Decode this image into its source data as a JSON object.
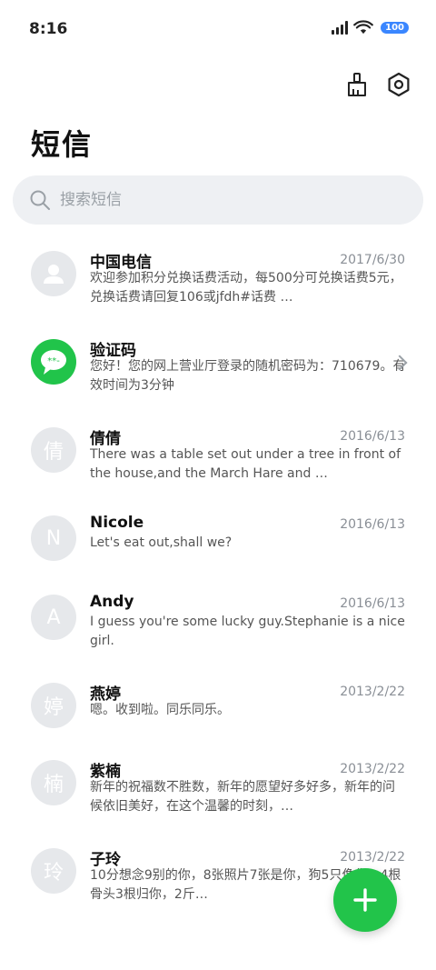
{
  "status": {
    "time": "8:16",
    "battery": "100"
  },
  "header": {
    "title": "短信"
  },
  "search": {
    "placeholder": "搜索短信"
  },
  "conversations": [
    {
      "name": "中国电信",
      "date": "2017/6/30",
      "preview": "欢迎参加积分兑换话费活动，每500分可兑换话费5元，兑换话费请回复106或jfdh#话费 …",
      "avatar": "person-icon"
    },
    {
      "name": "验证码",
      "date": "",
      "preview": "您好！您的网上营业厅登录的随机密码为：710679。有效时间为3分钟",
      "avatar": "message-icon"
    },
    {
      "name": "倩倩",
      "date": "2016/6/13",
      "preview": "There was a table set out under a tree in front of the house,and the March Hare and …",
      "avatar_letter": "倩"
    },
    {
      "name": "Nicole",
      "date": "2016/6/13",
      "preview": "Let's eat out,shall we?",
      "avatar_letter": "N"
    },
    {
      "name": "Andy",
      "date": "2016/6/13",
      "preview": "I guess you're some lucky guy.Stephanie is a nice girl.",
      "avatar_letter": "A"
    },
    {
      "name": "燕婷",
      "date": "2013/2/22",
      "preview": "嗯。收到啦。同乐同乐。",
      "avatar_letter": "婷"
    },
    {
      "name": "紫楠",
      "date": "2013/2/22",
      "preview": "新年的祝福数不胜数，新年的愿望好多好多，新年的问候依旧美好，在这个温馨的时刻，…",
      "avatar_letter": "楠"
    },
    {
      "name": "子玲",
      "date": "2013/2/22",
      "preview": "10分想念9别的你，8张照片7张是你，狗5只像你，4根骨头3根归你，2斤…",
      "avatar_letter": "玲"
    }
  ],
  "colors": {
    "accent": "#22c44a",
    "battery": "#3a86ff"
  }
}
